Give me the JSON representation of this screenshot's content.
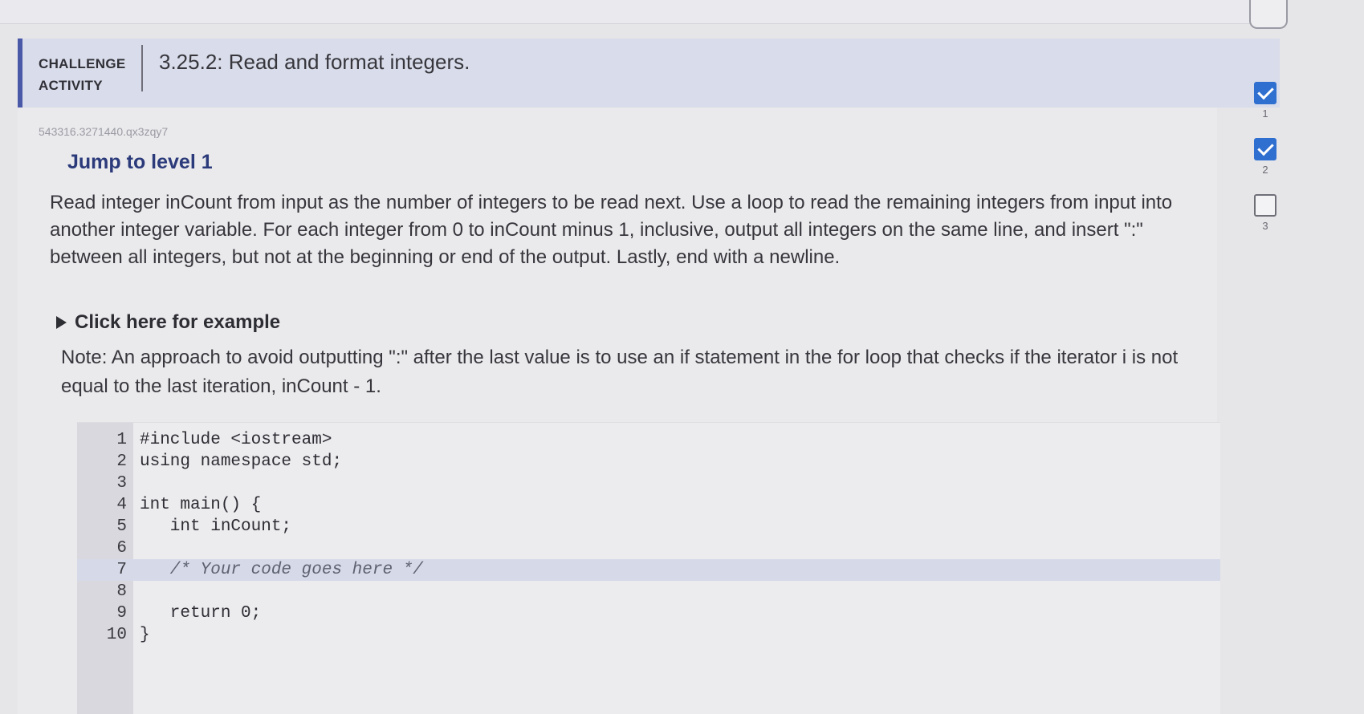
{
  "header": {
    "kicker": "CHALLENGE\nACTIVITY",
    "title": "3.25.2: Read and format integers."
  },
  "activity_id": "543316.3271440.qx3zqy7",
  "level_heading": "Jump to level 1",
  "prompt": "Read integer inCount from input as the number of integers to be read next. Use a loop to read the remaining integers from input into another integer variable. For each integer from 0 to inCount minus 1, inclusive, output all integers on the same line, and insert \":\" between all integers, but not at the beginning or end of the output. Lastly, end with a newline.",
  "example_toggle": "Click here for example",
  "note": "Note: An approach to avoid outputting \":\" after the last value is to use an if statement in the for loop that checks if the iterator i is not equal to the last iteration, inCount - 1.",
  "code_lines": [
    {
      "num": "1",
      "text": "#include <iostream>"
    },
    {
      "num": "2",
      "text": "using namespace std;"
    },
    {
      "num": "3",
      "text": ""
    },
    {
      "num": "4",
      "text": "int main() {"
    },
    {
      "num": "5",
      "text": "   int inCount;"
    },
    {
      "num": "6",
      "text": ""
    },
    {
      "num": "7",
      "text": "   /* Your code goes here */"
    },
    {
      "num": "8",
      "text": ""
    },
    {
      "num": "9",
      "text": "   return 0;"
    },
    {
      "num": "10",
      "text": "}"
    }
  ],
  "levels": [
    {
      "num": "1",
      "status": "complete"
    },
    {
      "num": "2",
      "status": "complete"
    },
    {
      "num": "3",
      "status": "incomplete"
    }
  ],
  "colors": {
    "accent": "#4a58a8",
    "level_heading": "#2b3a7a",
    "check_complete": "#2f6fd0"
  }
}
